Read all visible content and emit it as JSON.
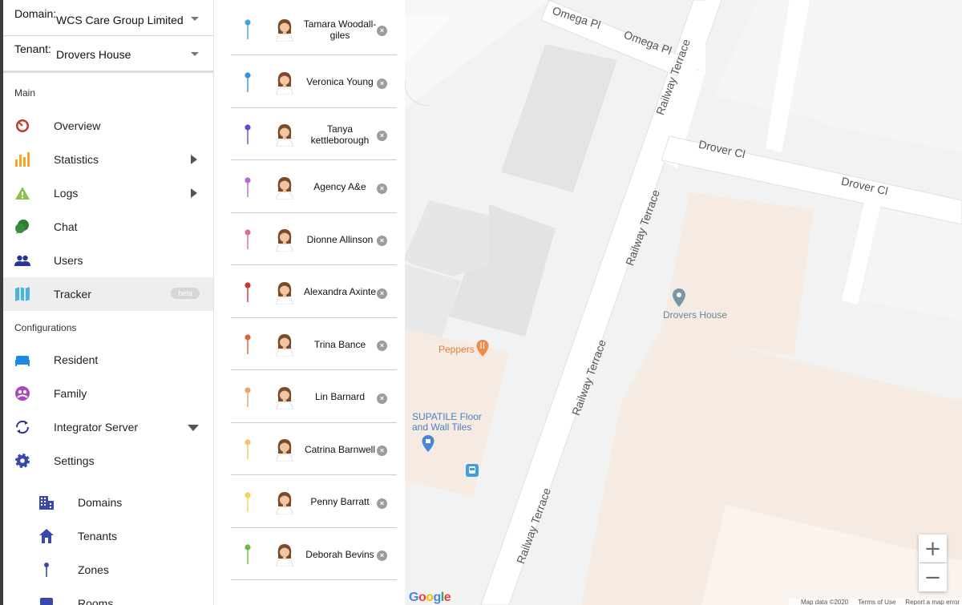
{
  "header": {
    "domain_label": "Domain:",
    "domain_value": "WCS Care Group Limited",
    "tenant_label": "Tenant:",
    "tenant_value": "Drovers House"
  },
  "sidebar": {
    "main_header": "Main",
    "config_header": "Configurations",
    "main_items": [
      {
        "label": "Overview",
        "icon": "overview-icon"
      },
      {
        "label": "Statistics",
        "icon": "bar-chart-icon"
      },
      {
        "label": "Logs",
        "icon": "warning-icon"
      },
      {
        "label": "Chat",
        "icon": "chat-icon"
      },
      {
        "label": "Users",
        "icon": "users-icon"
      },
      {
        "label": "Tracker",
        "icon": "map-icon",
        "badge": "beta"
      }
    ],
    "config_items": [
      {
        "label": "Resident",
        "icon": "bed-icon"
      },
      {
        "label": "Family",
        "icon": "family-icon"
      },
      {
        "label": "Integrator Server",
        "icon": "sync-icon"
      },
      {
        "label": "Settings",
        "icon": "gear-icon"
      },
      {
        "label": "Domains",
        "icon": "building-icon"
      },
      {
        "label": "Tenants",
        "icon": "home-icon"
      },
      {
        "label": "Zones",
        "icon": "pin-icon"
      },
      {
        "label": "Rooms",
        "icon": "room-icon"
      }
    ],
    "colors": {
      "accent": "#3949ab",
      "active_bg": "#eeeeee"
    }
  },
  "people": [
    {
      "name": "Tamara Woodall-giles",
      "pin_color": "#4aa3d8"
    },
    {
      "name": "Veronica Young",
      "pin_color": "#3d8fd9"
    },
    {
      "name": "Tanya kettleborough",
      "pin_color": "#5a4fcf"
    },
    {
      "name": "Agency A&e",
      "pin_color": "#b36ad9"
    },
    {
      "name": "Dionne Allinson",
      "pin_color": "#d96a9a"
    },
    {
      "name": "Alexandra Axinte",
      "pin_color": "#c8323b"
    },
    {
      "name": "Trina Bance",
      "pin_color": "#d9673a"
    },
    {
      "name": "Lin Barnard",
      "pin_color": "#efa070"
    },
    {
      "name": "Catrina Barnwell",
      "pin_color": "#f2c26e"
    },
    {
      "name": "Penny Barratt",
      "pin_color": "#f0d45a"
    },
    {
      "name": "Deborah Bevins",
      "pin_color": "#6bb84a"
    }
  ],
  "map": {
    "labels": {
      "omega1": "Omega Pl",
      "omega2": "Omega Pl",
      "railway1": "Railway Terrace",
      "railway2": "Railway Terrace",
      "railway3": "Railway Terrace",
      "railway4": "Railway Terrace",
      "drover1": "Drover Cl",
      "drover2": "Drover Cl",
      "drovers_house": "Drovers House",
      "peppers": "Peppers",
      "supatile1": "SUPATILE Floor",
      "supatile2": "and Wall Tiles"
    },
    "zoom_in": "+",
    "zoom_out": "−",
    "google": [
      "G",
      "o",
      "o",
      "g",
      "l",
      "e"
    ],
    "attribution": [
      "Map data ©2020",
      "Terms of Use",
      "Report a map error"
    ]
  }
}
